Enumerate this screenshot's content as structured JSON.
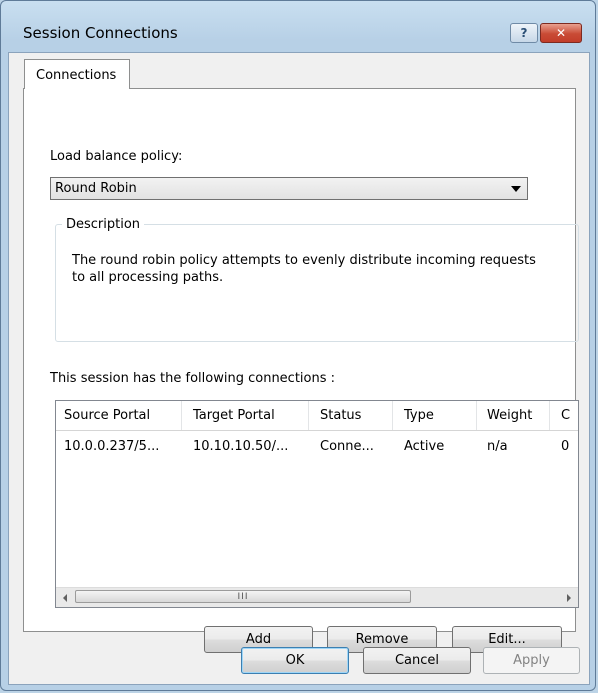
{
  "window": {
    "title": "Session Connections",
    "help_glyph": "?",
    "close_glyph": "✕"
  },
  "tabs": [
    "Connections"
  ],
  "policy": {
    "label": "Load balance policy:",
    "selected": "Round Robin"
  },
  "description": {
    "legend": "Description",
    "text": "The round robin policy attempts to evenly distribute incoming requests to all processing paths."
  },
  "connections": {
    "label": "This session has the following connections :",
    "columns": [
      "Source Portal",
      "Target Portal",
      "Status",
      "Type",
      "Weight",
      "C"
    ],
    "rows": [
      [
        "10.0.0.237/5...",
        "10.10.10.50/...",
        "Conne...",
        "Active",
        "n/a",
        "0"
      ]
    ],
    "scroll_thumb_glyph": "III"
  },
  "list_buttons": {
    "add": "Add",
    "remove": "Remove",
    "edit": "Edit..."
  },
  "dialog_buttons": {
    "ok": "OK",
    "cancel": "Cancel",
    "apply": "Apply"
  },
  "colors": {
    "frame": "#b7d0e6",
    "close_button": "#c94b35",
    "default_button_border": "#3c7fb1"
  }
}
